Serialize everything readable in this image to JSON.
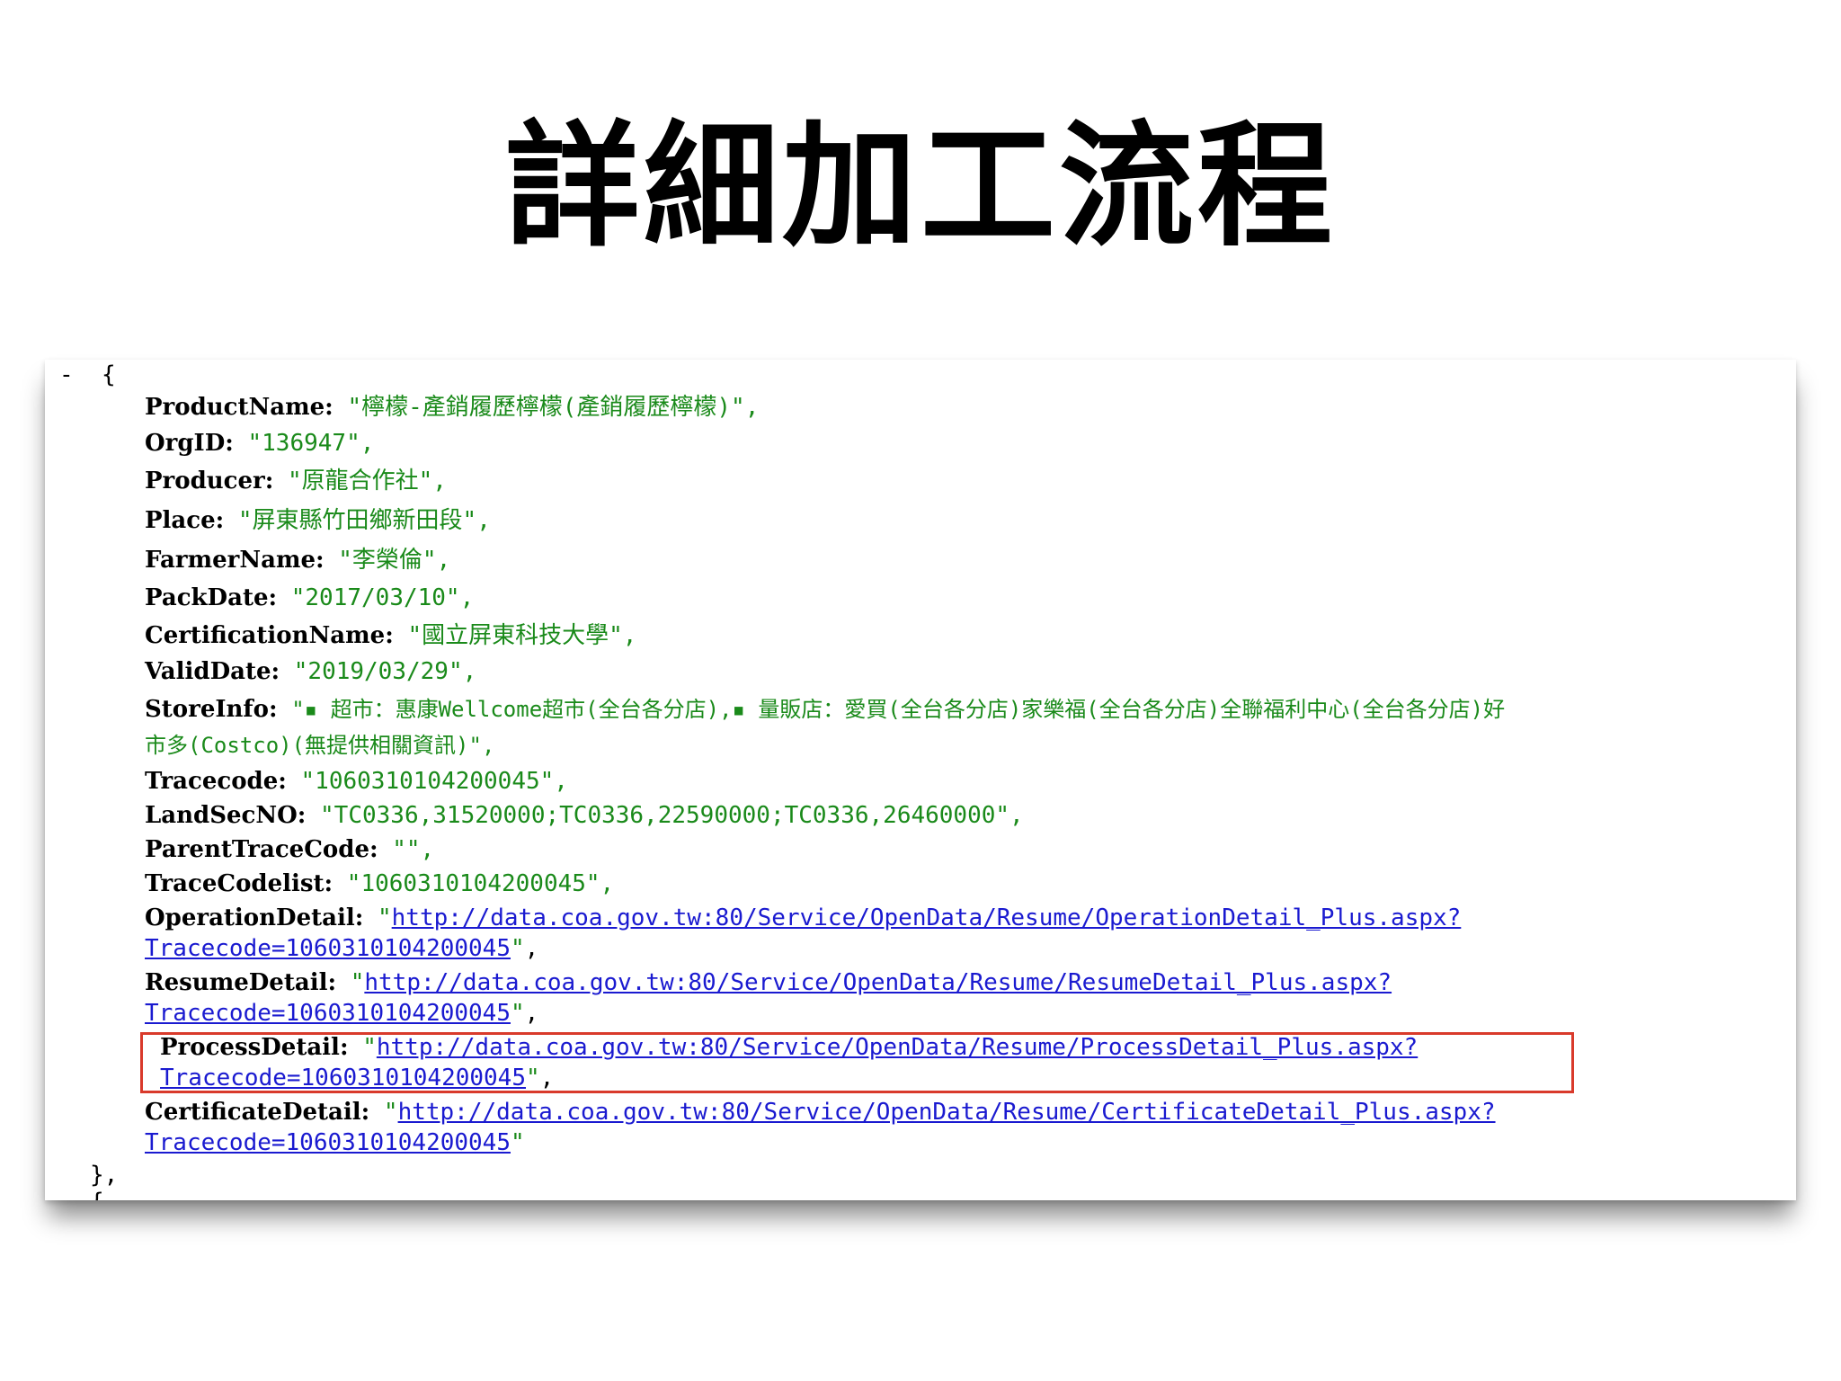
{
  "slide": {
    "title": "詳細加工流程"
  },
  "json_view": {
    "toggle": "-",
    "open": "{",
    "close": "},",
    "cut_line": "{",
    "quote": "\"",
    "comma": ",",
    "fields": {
      "product_name": {
        "key": "ProductName:",
        "value": "\"檸檬-產銷履歷檸檬(產銷履歷檸檬)\","
      },
      "org_id": {
        "key": "OrgID:",
        "value": "\"136947\","
      },
      "producer": {
        "key": "Producer:",
        "value": "\"原龍合作社\","
      },
      "place": {
        "key": "Place:",
        "value": "\"屏東縣竹田鄉新田段\","
      },
      "farmer_name": {
        "key": "FarmerName:",
        "value": "\"李榮倫\","
      },
      "pack_date": {
        "key": "PackDate:",
        "value": "\"2017/03/10\","
      },
      "certification_name": {
        "key": "CertificationName:",
        "value": "\"國立屏東科技大學\","
      },
      "valid_date": {
        "key": "ValidDate:",
        "value": "\"2019/03/29\","
      },
      "store_info": {
        "key": "StoreInfo:",
        "value_line1": "\"▪ 超市：惠康Wellcome超市(全台各分店),▪ 量販店：愛買(全台各分店)家樂福(全台各分店)全聯福利中心(全台各分店)好",
        "value_line2": "市多(Costco)(無提供相關資訊)\","
      },
      "tracecode": {
        "key": "Tracecode:",
        "value": "\"1060310104200045\","
      },
      "land_sec_no": {
        "key": "LandSecNO:",
        "value": "\"TC0336,31520000;TC0336,22590000;TC0336,26460000\","
      },
      "parent_trace_code": {
        "key": "ParentTraceCode:",
        "value": "\"\","
      },
      "trace_code_list": {
        "key": "TraceCodelist:",
        "value": "\"1060310104200045\","
      },
      "operation_detail": {
        "key": "OperationDetail:",
        "url_line1": "http://data.coa.gov.tw:80/Service/OpenData/Resume/OperationDetail_Plus.aspx?",
        "url_line2": "Tracecode=1060310104200045"
      },
      "resume_detail": {
        "key": "ResumeDetail:",
        "url_line1": "http://data.coa.gov.tw:80/Service/OpenData/Resume/ResumeDetail_Plus.aspx?",
        "url_line2": "Tracecode=1060310104200045"
      },
      "process_detail": {
        "key": "ProcessDetail:",
        "url_line1": "http://data.coa.gov.tw:80/Service/OpenData/Resume/ProcessDetail_Plus.aspx?",
        "url_line2": "Tracecode=1060310104200045"
      },
      "certificate_detail": {
        "key": "CertificateDetail:",
        "url_line1": "http://data.coa.gov.tw:80/Service/OpenData/Resume/CertificateDetail_Plus.aspx?",
        "url_line2": "Tracecode=1060310104200045"
      }
    },
    "colors": {
      "string": "#1a8a1a",
      "link": "#1a1ad0",
      "highlight_border": "#d93a2b"
    }
  }
}
